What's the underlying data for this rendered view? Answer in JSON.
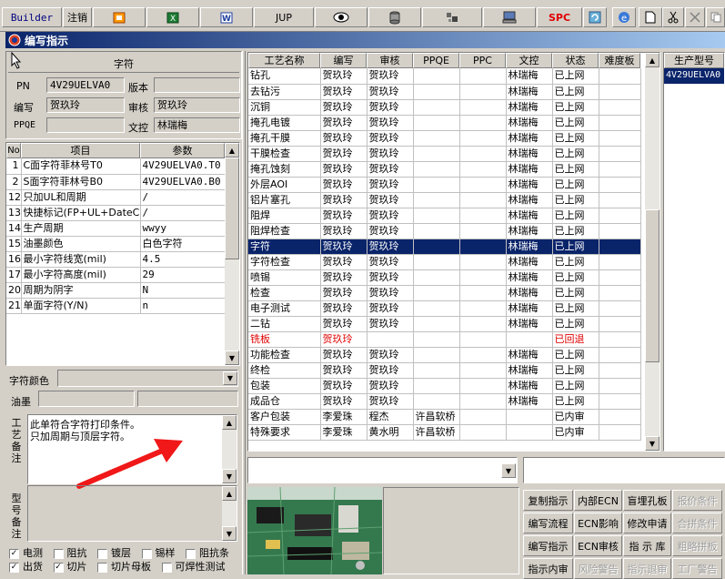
{
  "toolbar": {
    "builder": "Builder",
    "logout": "注销",
    "jup": "JUP",
    "spc": "SPC",
    "icons": [
      "orange-icon",
      "excel-icon",
      "word-icon",
      "eye-icon",
      "database-icon",
      "settings-icon",
      "computer-icon",
      "refresh-icon",
      "ie-icon",
      "new-page-icon",
      "scissors-icon",
      "close-icon",
      "copy-icon"
    ]
  },
  "window": {
    "title": "编写指示"
  },
  "form": {
    "section_title": "字符",
    "pn_label": "PN",
    "pn_value": "4V29UELVA0",
    "version_label": "版本",
    "version_value": "",
    "writer_label": "编写",
    "writer_value": "贺玖玲",
    "reviewer_label": "审核",
    "reviewer_value": "贺玖玲",
    "ppqe_label": "PPQE",
    "ppqe_value": "",
    "doc_label": "文控",
    "doc_value": "林瑞梅"
  },
  "params": {
    "headers": [
      "No",
      "项目",
      "参数"
    ],
    "rows": [
      [
        "1",
        "C面字符菲林号T0",
        "4V29UELVA0.T0"
      ],
      [
        "2",
        "S面字符菲林号B0",
        "4V29UELVA0.B0"
      ],
      [
        "12",
        "只加UL和周期",
        "/"
      ],
      [
        "13",
        "快捷标记(FP+UL+DateCo",
        "/"
      ],
      [
        "14",
        "生产周期",
        "wwyy"
      ],
      [
        "15",
        "油墨颜色",
        "白色字符"
      ],
      [
        "16",
        "最小字符线宽(mil)",
        "4.5"
      ],
      [
        "17",
        "最小字符高度(mil)",
        "29"
      ],
      [
        "20",
        "周期为阴字",
        "N"
      ],
      [
        "21",
        "单面字符(Y/N)",
        "n"
      ]
    ]
  },
  "color_label": "字符颜色",
  "ink_label": "油墨",
  "process_note_label": "工艺备注",
  "process_note_lines": [
    "此单符合字符打印条件。",
    "只加周期与顶层字符。"
  ],
  "type_note_label": "型号备注",
  "checkboxes": [
    {
      "label": "电测",
      "checked": true
    },
    {
      "label": "阻抗",
      "checked": false
    },
    {
      "label": "镀层",
      "checked": false
    },
    {
      "label": "锡样",
      "checked": false
    },
    {
      "label": "阻抗条",
      "checked": false
    },
    {
      "label": "出货",
      "checked": true
    },
    {
      "label": "切片",
      "checked": true
    },
    {
      "label": "切片母板",
      "checked": false
    },
    {
      "label": "可焊性测试",
      "checked": false
    }
  ],
  "process_table": {
    "headers": [
      "工艺名称",
      "编写",
      "审核",
      "PPQE",
      "PPC",
      "文控",
      "状态",
      "难度板"
    ],
    "rows": [
      [
        "钻孔",
        "贺玖玲",
        "贺玖玲",
        "",
        "",
        "林瑞梅",
        "已上网",
        ""
      ],
      [
        "去钻污",
        "贺玖玲",
        "贺玖玲",
        "",
        "",
        "林瑞梅",
        "已上网",
        ""
      ],
      [
        "沉铜",
        "贺玖玲",
        "贺玖玲",
        "",
        "",
        "林瑞梅",
        "已上网",
        ""
      ],
      [
        "掩孔电镀",
        "贺玖玲",
        "贺玖玲",
        "",
        "",
        "林瑞梅",
        "已上网",
        ""
      ],
      [
        "掩孔干膜",
        "贺玖玲",
        "贺玖玲",
        "",
        "",
        "林瑞梅",
        "已上网",
        ""
      ],
      [
        "干膜检查",
        "贺玖玲",
        "贺玖玲",
        "",
        "",
        "林瑞梅",
        "已上网",
        ""
      ],
      [
        "掩孔蚀刻",
        "贺玖玲",
        "贺玖玲",
        "",
        "",
        "林瑞梅",
        "已上网",
        ""
      ],
      [
        "外层AOI",
        "贺玖玲",
        "贺玖玲",
        "",
        "",
        "林瑞梅",
        "已上网",
        ""
      ],
      [
        "铝片塞孔",
        "贺玖玲",
        "贺玖玲",
        "",
        "",
        "林瑞梅",
        "已上网",
        ""
      ],
      [
        "阻焊",
        "贺玖玲",
        "贺玖玲",
        "",
        "",
        "林瑞梅",
        "已上网",
        ""
      ],
      [
        "阻焊检查",
        "贺玖玲",
        "贺玖玲",
        "",
        "",
        "林瑞梅",
        "已上网",
        ""
      ],
      [
        "字符",
        "贺玖玲",
        "贺玖玲",
        "",
        "",
        "林瑞梅",
        "已上网",
        ""
      ],
      [
        "字符检查",
        "贺玖玲",
        "贺玖玲",
        "",
        "",
        "林瑞梅",
        "已上网",
        ""
      ],
      [
        "喷锡",
        "贺玖玲",
        "贺玖玲",
        "",
        "",
        "林瑞梅",
        "已上网",
        ""
      ],
      [
        "检查",
        "贺玖玲",
        "贺玖玲",
        "",
        "",
        "林瑞梅",
        "已上网",
        ""
      ],
      [
        "电子测试",
        "贺玖玲",
        "贺玖玲",
        "",
        "",
        "林瑞梅",
        "已上网",
        ""
      ],
      [
        "二钻",
        "贺玖玲",
        "贺玖玲",
        "",
        "",
        "林瑞梅",
        "已上网",
        ""
      ],
      [
        "铣板",
        "贺玖玲",
        "",
        "",
        "",
        "",
        "已回退",
        ""
      ],
      [
        "功能检查",
        "贺玖玲",
        "贺玖玲",
        "",
        "",
        "林瑞梅",
        "已上网",
        ""
      ],
      [
        "终检",
        "贺玖玲",
        "贺玖玲",
        "",
        "",
        "林瑞梅",
        "已上网",
        ""
      ],
      [
        "包装",
        "贺玖玲",
        "贺玖玲",
        "",
        "",
        "林瑞梅",
        "已上网",
        ""
      ],
      [
        "成品仓",
        "贺玖玲",
        "贺玖玲",
        "",
        "",
        "林瑞梅",
        "已上网",
        ""
      ],
      [
        "客户包装",
        "李爱珠",
        "程杰",
        "许昌软桥",
        "",
        "",
        "已内审",
        ""
      ],
      [
        "特殊要求",
        "李爱珠",
        "黄水明",
        "许昌软桥",
        "",
        "",
        "已内审",
        ""
      ]
    ],
    "selected_index": 11,
    "red_index": 17
  },
  "model_panel": {
    "header": "生产型号",
    "value": "4V29UELVA0"
  },
  "actions": [
    [
      "复制指示",
      "内部ECN",
      "盲埋孔板",
      "报价条件"
    ],
    [
      "编写流程",
      "ECN影响",
      "修改申请",
      "合拼条件"
    ],
    [
      "编写指示",
      "ECN审核",
      "指 示 库",
      "粗略拼板"
    ],
    [
      "指示内审",
      "风险警告",
      "指示退审",
      "工厂警告"
    ]
  ],
  "disabled_actions": [
    "报价条件",
    "合拼条件",
    "粗略拼板",
    "风险警告",
    "指示退审",
    "工厂警告"
  ]
}
